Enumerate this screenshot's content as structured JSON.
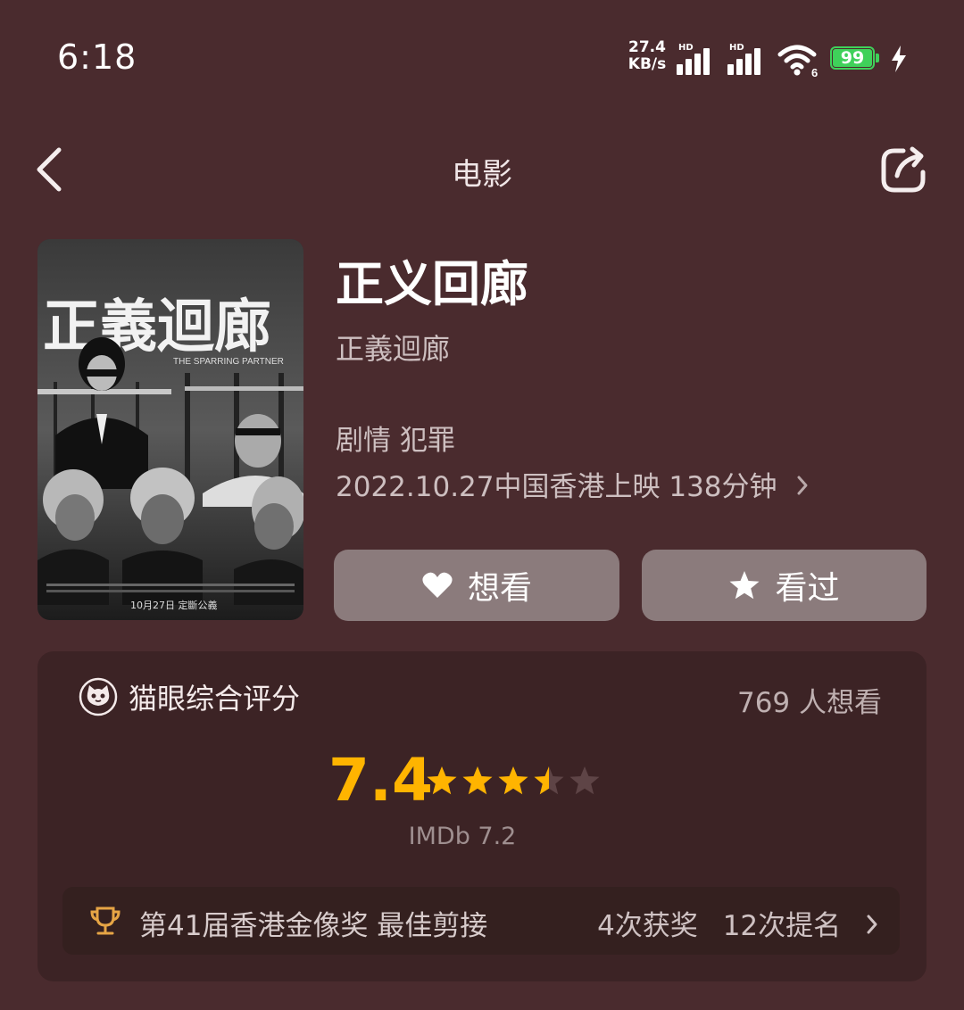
{
  "status_bar": {
    "time": "6:18",
    "net_speed_value": "27.4",
    "net_speed_unit": "KB/s",
    "signal1_label": "HD",
    "signal2_label": "HD",
    "wifi_label": "6",
    "battery": "99"
  },
  "nav": {
    "title": "电影",
    "back_icon": "chevron-left-icon",
    "share_icon": "share-icon"
  },
  "movie": {
    "title": "正义回廊",
    "original_title": "正義迴廊",
    "genres": "剧情 犯罪",
    "release_info": "2022.10.27中国香港上映 138分钟",
    "poster": {
      "title_text": "正義迴廊",
      "english_title": "THE SPARRING PARTNER",
      "date_text": "10月27日 定斷公義"
    }
  },
  "actions": {
    "want_label": "想看",
    "seen_label": "看过"
  },
  "rating": {
    "label": "猫眼综合评分",
    "want_count": "769 人想看",
    "score": "7.4",
    "stars_out_of_5": 3.5,
    "imdb": "IMDb 7.2",
    "accent_color": "#ffb400"
  },
  "award": {
    "title": "第41届香港金像奖 最佳剪接",
    "wins": "4次获奖",
    "nominations": "12次提名"
  }
}
